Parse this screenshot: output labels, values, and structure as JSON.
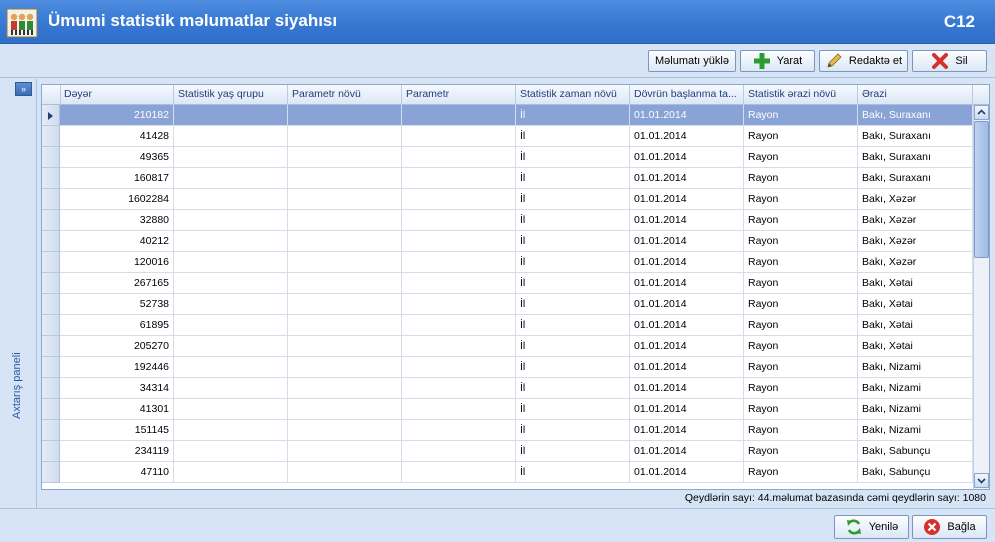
{
  "window": {
    "title": "Ümumi statistik məlumatlar siyahısı",
    "code": "C12"
  },
  "toolbar": {
    "load_label": "Məlumatı yüklə",
    "create_label": "Yarat",
    "edit_label": "Redaktə et",
    "delete_label": "Sil"
  },
  "side_panel": {
    "label": "Axtarış paneli",
    "toggle_glyph": "»"
  },
  "grid": {
    "columns": [
      "Dəyər",
      "Statistik yaş qrupu",
      "Parametr növü",
      "Parametr",
      "Statistik zaman növü",
      "Dövrün başlanma ta...",
      "Statistik ərazi növü",
      "Ərazi"
    ],
    "rows": [
      [
        "210182",
        "",
        "",
        "",
        "İl",
        "01.01.2014",
        "Rayon",
        "Bakı, Suraxanı"
      ],
      [
        "41428",
        "",
        "",
        "",
        "İl",
        "01.01.2014",
        "Rayon",
        "Bakı, Suraxanı"
      ],
      [
        "49365",
        "",
        "",
        "",
        "İl",
        "01.01.2014",
        "Rayon",
        "Bakı, Suraxanı"
      ],
      [
        "160817",
        "",
        "",
        "",
        "İl",
        "01.01.2014",
        "Rayon",
        "Bakı, Suraxanı"
      ],
      [
        "1602284",
        "",
        "",
        "",
        "İl",
        "01.01.2014",
        "Rayon",
        "Bakı, Xəzər"
      ],
      [
        "32880",
        "",
        "",
        "",
        "İl",
        "01.01.2014",
        "Rayon",
        "Bakı, Xəzər"
      ],
      [
        "40212",
        "",
        "",
        "",
        "İl",
        "01.01.2014",
        "Rayon",
        "Bakı, Xəzər"
      ],
      [
        "120016",
        "",
        "",
        "",
        "İl",
        "01.01.2014",
        "Rayon",
        "Bakı, Xəzər"
      ],
      [
        "267165",
        "",
        "",
        "",
        "İl",
        "01.01.2014",
        "Rayon",
        "Bakı, Xətai"
      ],
      [
        "52738",
        "",
        "",
        "",
        "İl",
        "01.01.2014",
        "Rayon",
        "Bakı, Xətai"
      ],
      [
        "61895",
        "",
        "",
        "",
        "İl",
        "01.01.2014",
        "Rayon",
        "Bakı, Xətai"
      ],
      [
        "205270",
        "",
        "",
        "",
        "İl",
        "01.01.2014",
        "Rayon",
        "Bakı, Xətai"
      ],
      [
        "192446",
        "",
        "",
        "",
        "İl",
        "01.01.2014",
        "Rayon",
        "Bakı, Nizami"
      ],
      [
        "34314",
        "",
        "",
        "",
        "İl",
        "01.01.2014",
        "Rayon",
        "Bakı, Nizami"
      ],
      [
        "41301",
        "",
        "",
        "",
        "İl",
        "01.01.2014",
        "Rayon",
        "Bakı, Nizami"
      ],
      [
        "151145",
        "",
        "",
        "",
        "İl",
        "01.01.2014",
        "Rayon",
        "Bakı, Nizami"
      ],
      [
        "234119",
        "",
        "",
        "",
        "İl",
        "01.01.2014",
        "Rayon",
        "Bakı, Sabunçu"
      ],
      [
        "47110",
        "",
        "",
        "",
        "İl",
        "01.01.2014",
        "Rayon",
        "Bakı, Sabunçu"
      ]
    ],
    "selected_row": 0
  },
  "status": {
    "text": "Qeydlərin sayı: 44.məlumat bazasında cəmi qeydlərin sayı: 1080"
  },
  "footer": {
    "refresh_label": "Yenilə",
    "close_label": "Bağla"
  },
  "colors": {
    "titlebar": "#3a7bd5",
    "selected_row": "#8aa3d6",
    "create_icon": "#2e9b2e",
    "delete_icon": "#d6322b"
  }
}
